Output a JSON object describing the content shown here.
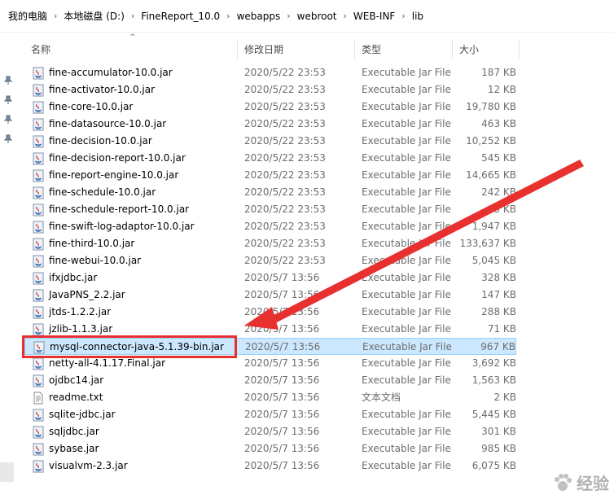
{
  "breadcrumb": [
    "我的电脑",
    "本地磁盘 (D:)",
    "FineReport_10.0",
    "webapps",
    "webroot",
    "WEB-INF",
    "lib"
  ],
  "columns": {
    "name": "名称",
    "date": "修改日期",
    "type": "类型",
    "size": "大小"
  },
  "files": [
    {
      "name": "fine-accumulator-10.0.jar",
      "date": "2020/5/22 23:53",
      "type": "Executable Jar File",
      "size": "187 KB",
      "icon": "jar-icon"
    },
    {
      "name": "fine-activator-10.0.jar",
      "date": "2020/5/22 23:53",
      "type": "Executable Jar File",
      "size": "12 KB",
      "icon": "jar-icon"
    },
    {
      "name": "fine-core-10.0.jar",
      "date": "2020/5/22 23:53",
      "type": "Executable Jar File",
      "size": "19,780 KB",
      "icon": "jar-icon"
    },
    {
      "name": "fine-datasource-10.0.jar",
      "date": "2020/5/22 23:53",
      "type": "Executable Jar File",
      "size": "463 KB",
      "icon": "jar-icon"
    },
    {
      "name": "fine-decision-10.0.jar",
      "date": "2020/5/22 23:53",
      "type": "Executable Jar File",
      "size": "10,252 KB",
      "icon": "jar-icon"
    },
    {
      "name": "fine-decision-report-10.0.jar",
      "date": "2020/5/22 23:53",
      "type": "Executable Jar File",
      "size": "545 KB",
      "icon": "jar-icon"
    },
    {
      "name": "fine-report-engine-10.0.jar",
      "date": "2020/5/22 23:53",
      "type": "Executable Jar File",
      "size": "14,665 KB",
      "icon": "jar-icon"
    },
    {
      "name": "fine-schedule-10.0.jar",
      "date": "2020/5/22 23:53",
      "type": "Executable Jar File",
      "size": "242 KB",
      "icon": "jar-icon"
    },
    {
      "name": "fine-schedule-report-10.0.jar",
      "date": "2020/5/22 23:53",
      "type": "Executable Jar File",
      "size": "83 KB",
      "icon": "jar-icon"
    },
    {
      "name": "fine-swift-log-adaptor-10.0.jar",
      "date": "2020/5/22 23:53",
      "type": "Executable Jar File",
      "size": "1,947 KB",
      "icon": "jar-icon"
    },
    {
      "name": "fine-third-10.0.jar",
      "date": "2020/5/22 23:53",
      "type": "Executable Jar File",
      "size": "133,637 KB",
      "icon": "jar-icon"
    },
    {
      "name": "fine-webui-10.0.jar",
      "date": "2020/5/22 23:53",
      "type": "Executable Jar File",
      "size": "5,045 KB",
      "icon": "jar-icon"
    },
    {
      "name": "ifxjdbc.jar",
      "date": "2020/5/7 13:56",
      "type": "Executable Jar File",
      "size": "328 KB",
      "icon": "jar-icon"
    },
    {
      "name": "JavaPNS_2.2.jar",
      "date": "2020/5/7 13:56",
      "type": "Executable Jar File",
      "size": "147 KB",
      "icon": "jar-icon"
    },
    {
      "name": "jtds-1.2.2.jar",
      "date": "2020/5/7 13:56",
      "type": "Executable Jar File",
      "size": "288 KB",
      "icon": "jar-icon"
    },
    {
      "name": "jzlib-1.1.3.jar",
      "date": "2020/5/7 13:56",
      "type": "Executable Jar File",
      "size": "71 KB",
      "icon": "jar-icon"
    },
    {
      "name": "mysql-connector-java-5.1.39-bin.jar",
      "date": "2020/5/7 13:56",
      "type": "Executable Jar File",
      "size": "967 KB",
      "icon": "jar-icon",
      "selected": true
    },
    {
      "name": "netty-all-4.1.17.Final.jar",
      "date": "2020/5/7 13:56",
      "type": "Executable Jar File",
      "size": "3,692 KB",
      "icon": "jar-icon"
    },
    {
      "name": "ojdbc14.jar",
      "date": "2020/5/7 13:56",
      "type": "Executable Jar File",
      "size": "1,563 KB",
      "icon": "jar-icon"
    },
    {
      "name": "readme.txt",
      "date": "2020/5/7 13:56",
      "type": "文本文档",
      "size": "2 KB",
      "icon": "text-file-icon"
    },
    {
      "name": "sqlite-jdbc.jar",
      "date": "2020/5/7 13:56",
      "type": "Executable Jar File",
      "size": "5,445 KB",
      "icon": "jar-icon"
    },
    {
      "name": "sqljdbc.jar",
      "date": "2020/5/7 13:56",
      "type": "Executable Jar File",
      "size": "301 KB",
      "icon": "jar-icon"
    },
    {
      "name": "sybase.jar",
      "date": "2020/5/7 13:56",
      "type": "Executable Jar File",
      "size": "985 KB",
      "icon": "jar-icon"
    },
    {
      "name": "visualvm-2.3.jar",
      "date": "2020/5/7 13:56",
      "type": "Executable Jar File",
      "size": "6,075 KB",
      "icon": "jar-icon"
    }
  ],
  "watermark": {
    "text": "经验"
  },
  "colors": {
    "selection": "#cce8ff",
    "selection_border": "#99d1ff",
    "annotation": "#e8302f"
  }
}
